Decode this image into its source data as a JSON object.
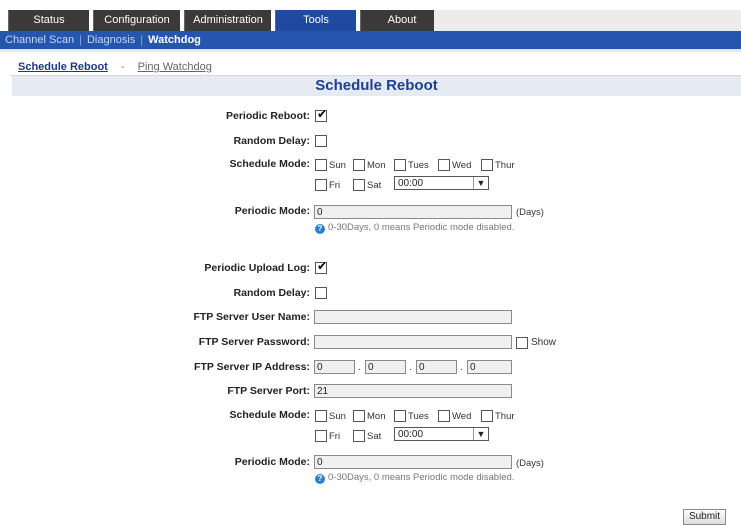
{
  "top_tabs": [
    "Status",
    "Configuration",
    "Administration",
    "Tools",
    "About"
  ],
  "active_tab": "Tools",
  "sub_nav": [
    "Channel Scan",
    "Diagnosis",
    "Watchdog"
  ],
  "active_sub": "Watchdog",
  "page_nav": {
    "current": "Schedule Reboot",
    "separator": "-",
    "other": "Ping Watchdog"
  },
  "section_title": "Schedule Reboot",
  "reboot": {
    "periodic_label": "Periodic Reboot:",
    "periodic_checked": true,
    "random_delay_label": "Random Delay:",
    "random_delay_checked": false,
    "schedule_mode_label": "Schedule Mode:",
    "days_row1": [
      "Sun",
      "Mon",
      "Tues",
      "Wed",
      "Thur"
    ],
    "days_row2": [
      "Fri",
      "Sat"
    ],
    "time_value": "00:00",
    "periodic_mode_label": "Periodic Mode:",
    "periodic_mode_value": "0",
    "unit": "(Days)",
    "hint": "0-30Days, 0 means Periodic mode disabled."
  },
  "upload": {
    "periodic_label": "Periodic Upload Log:",
    "periodic_checked": true,
    "random_delay_label": "Random Delay:",
    "random_delay_checked": false,
    "ftp_user_label": "FTP Server User Name:",
    "ftp_user_value": "",
    "ftp_password_label": "FTP Server Password:",
    "ftp_password_value": "",
    "show_label": "Show",
    "ftp_ip_label": "FTP Server IP Address:",
    "ftp_ip": [
      "0",
      "0",
      "0",
      "0"
    ],
    "ftp_port_label": "FTP Server Port:",
    "ftp_port_value": "21",
    "schedule_mode_label": "Schedule Mode:",
    "days_row1": [
      "Sun",
      "Mon",
      "Tues",
      "Wed",
      "Thur"
    ],
    "days_row2": [
      "Fri",
      "Sat"
    ],
    "time_value": "00:00",
    "periodic_mode_label": "Periodic Mode:",
    "periodic_mode_value": "0",
    "unit": "(Days)",
    "hint": "0-30Days, 0 means Periodic mode disabled."
  },
  "submit_label": "Submit"
}
